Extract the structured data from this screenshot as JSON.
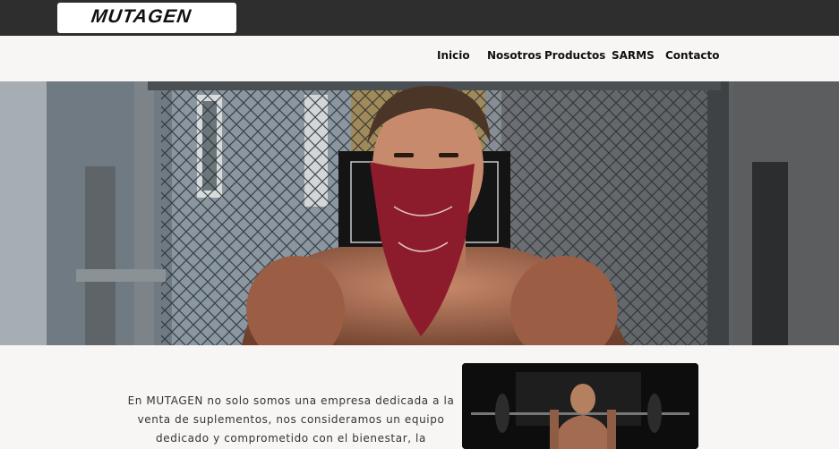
{
  "brand": {
    "logo_text": "MUTAGEN"
  },
  "nav": {
    "items": [
      {
        "label": "Inicio"
      },
      {
        "label": "Nosotros"
      },
      {
        "label": "Productos"
      },
      {
        "label": "SARMS"
      },
      {
        "label": "Contacto"
      }
    ]
  },
  "hero": {
    "image": "man-with-red-bandana-chainlink-fence"
  },
  "about": {
    "text": "En MUTAGEN no solo somos una empresa dedicada a la venta de suplementos, nos consideramos un equipo dedicado y comprometido con el bienestar, la",
    "image": "man-lifting-barbell-gym"
  },
  "colors": {
    "topbar": "#2e2e2e",
    "page_bg": "#f8f6f4",
    "bandana": "#8c1c2c"
  }
}
